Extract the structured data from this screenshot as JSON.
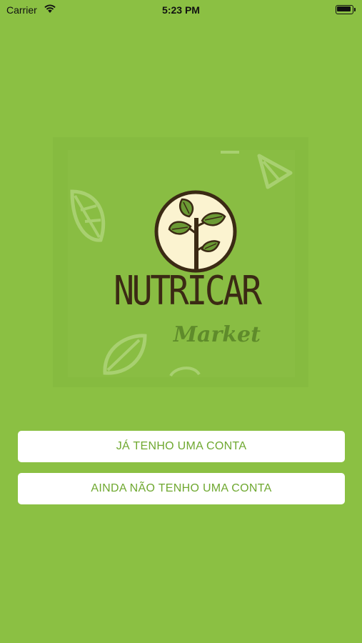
{
  "status_bar": {
    "carrier": "Carrier",
    "time": "5:23 PM",
    "icons": [
      "wifi-icon",
      "battery-icon"
    ]
  },
  "logo": {
    "brand_name": "NUTRICAR",
    "brand_sub": "Market",
    "emblem_icon": "plant-leaves-icon"
  },
  "actions": {
    "login_label": "JÁ TENHO UMA CONTA",
    "signup_label": "AINDA NÃO TENHO UMA CONTA"
  },
  "colors": {
    "background": "#8bc043",
    "button_background": "#ffffff",
    "button_text": "#6fa830",
    "brand_dark": "#3b2a14",
    "brand_sub": "#5f8b2b",
    "emblem_fill": "#fbf3d0"
  }
}
